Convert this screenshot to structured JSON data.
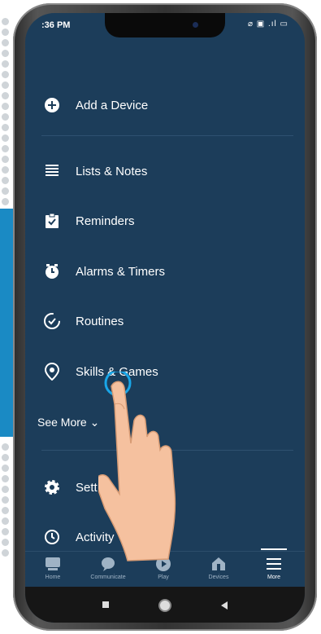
{
  "status_bar": {
    "time": ":36 PM",
    "icons": "⌀ ▣ .ıl ▭"
  },
  "menu": {
    "add_device": "Add a Device",
    "items": [
      {
        "label": "Lists & Notes"
      },
      {
        "label": "Reminders"
      },
      {
        "label": "Alarms & Timers"
      },
      {
        "label": "Routines"
      },
      {
        "label": "Skills & Games"
      }
    ],
    "see_more": "See More",
    "settings": "Sett",
    "activity": "Activity"
  },
  "bottom_nav": [
    {
      "label": "Home"
    },
    {
      "label": "Communicate"
    },
    {
      "label": "Play"
    },
    {
      "label": "Devices"
    },
    {
      "label": "More"
    }
  ],
  "colors": {
    "screen_bg": "#1c3d5a",
    "accent_blue": "#1a8ac4",
    "tap_ring": "#19a6e8"
  }
}
